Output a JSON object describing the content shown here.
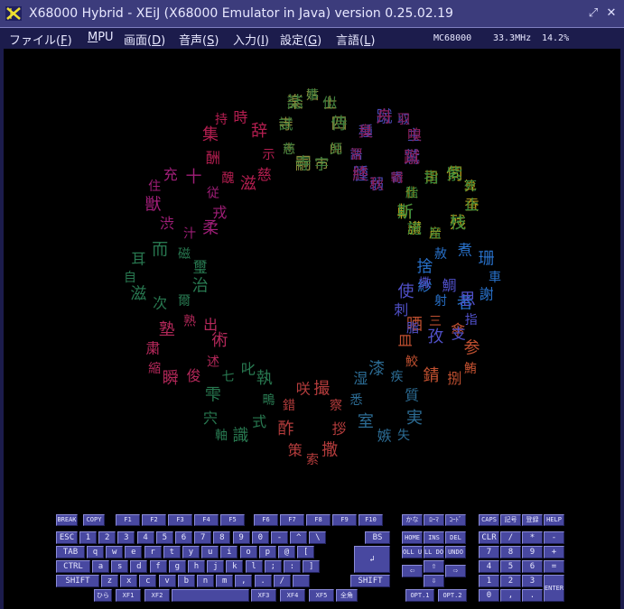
{
  "window": {
    "title": "X68000 Hybrid - XEiJ (X68000 Emulator in Java) version 0.25.02.19",
    "app_icon": "xeij-logo-icon",
    "buttons": [
      "restore-icon",
      "close-icon"
    ]
  },
  "menu": {
    "items": [
      {
        "label": "ファイル(",
        "key": "F",
        "close": ")"
      },
      {
        "label": "",
        "key": "M",
        "close": "PU"
      },
      {
        "label": "画面(",
        "key": "D",
        "close": ")"
      },
      {
        "label": "音声(",
        "key": "S",
        "close": ")"
      },
      {
        "label": "入力(",
        "key": "I",
        "close": ")"
      },
      {
        "label": "設定(",
        "key": "G",
        "close": ")"
      },
      {
        "label": "言語(",
        "key": "L",
        "close": ")"
      }
    ],
    "status": {
      "model": "MC68000",
      "clock": "33.3MHz",
      "load": "14.2%"
    }
  },
  "screen": {
    "petals": [
      {
        "angle": -90,
        "color": "#8c8c3c",
        "words": [
          "姑",
          "士",
          "四",
          "師",
          "市",
          "嗣",
          "志",
          "寺",
          "楽"
        ]
      },
      {
        "angle": -60,
        "color": "#4848b4",
        "words": [
          "取",
          "主",
          "鷲",
          "寄",
          "弱",
          "腫",
          "語",
          "種",
          "蹴"
        ]
      },
      {
        "angle": -30,
        "color": "#b49c1c",
        "words": [
          "算",
          "蚕",
          "残",
          "産",
          "讃",
          "斬",
          "仕",
          "司",
          "伺"
        ]
      },
      {
        "angle": 0,
        "color": "#2870c8",
        "words": [
          "車",
          "謝",
          "者",
          "射",
          "紗",
          "捨",
          "赦",
          "煮",
          "珊"
        ]
      },
      {
        "angle": 30,
        "color": "#c05030",
        "words": [
          "鮪",
          "捌",
          "錆",
          "鮫",
          "皿",
          "晒",
          "三",
          "傘",
          "参"
        ]
      },
      {
        "angle": 60,
        "color": "#2c6c94",
        "words": [
          "失",
          "嫉",
          "室",
          "悉",
          "湿",
          "漆",
          "疾",
          "質",
          "実"
        ]
      },
      {
        "angle": 90,
        "color": "#b43c3c",
        "words": [
          "索",
          "策",
          "酢",
          "錯",
          "咲",
          "撮",
          "察",
          "拶",
          "撒"
        ]
      },
      {
        "angle": 120,
        "color": "#287850",
        "words": [
          "軸",
          "宍",
          "雫",
          "七",
          "叱",
          "執",
          "鴫",
          "式",
          "識"
        ]
      },
      {
        "angle": 150,
        "color": "#b4285a",
        "words": [
          "縮",
          "粛",
          "塾",
          "熟",
          "出",
          "術",
          "述",
          "俊",
          "瞬"
        ]
      },
      {
        "angle": 180,
        "color": "#287850",
        "words": [
          "自",
          "耳",
          "而",
          "磁",
          "璽",
          "治",
          "爾",
          "次",
          "滋"
        ]
      },
      {
        "angle": 210,
        "color": "#a01e78",
        "words": [
          "住",
          "充",
          "十",
          "従",
          "戎",
          "柔",
          "汁",
          "渋",
          "獣"
        ]
      },
      {
        "angle": 240,
        "color": "#b41e50",
        "words": [
          "持",
          "時",
          "辞",
          "示",
          "慈",
          "滋",
          "醜",
          "酬",
          "集"
        ]
      },
      {
        "angle": 270,
        "color": "#3c7c3c",
        "words": [
          "事",
          "似",
          "侍",
          "児",
          "字",
          "寺",
          "慈",
          "試",
          "誌"
        ]
      },
      {
        "angle": 300,
        "color": "#8c1e5a",
        "words": [
          "羽",
          "嗅",
          "蹴",
          "輯",
          "秋",
          "終",
          "習",
          "臭",
          "舟"
        ]
      },
      {
        "angle": 330,
        "color": "#3c8c3c",
        "words": [
          "死",
          "止",
          "枝",
          "旨",
          "施",
          "斯",
          "脂",
          "指",
          "紫"
        ]
      },
      {
        "angle": 15,
        "color": "#5050c8",
        "words": [
          "指",
          "支",
          "孜",
          "脂",
          "刺",
          "使",
          "撒",
          "鯛",
          "思"
        ]
      }
    ]
  },
  "keyboard": {
    "row0_left": [
      "BREAK",
      "COPY"
    ],
    "fkeys": [
      "F1",
      "F2",
      "F3",
      "F4",
      "F5",
      "F6",
      "F7",
      "F8",
      "F9",
      "F10"
    ],
    "row0_mid": [
      "かな",
      "ﾛｰﾏ",
      "ｺｰﾄﾞ"
    ],
    "row0_right": [
      "CAPS",
      "記号",
      "登録",
      "HELP"
    ],
    "row1": [
      "ESC",
      "1",
      "2",
      "3",
      "4",
      "5",
      "6",
      "7",
      "8",
      "9",
      "0",
      "-",
      "^",
      "\\",
      "BS"
    ],
    "row2": [
      "TAB",
      "q",
      "w",
      "e",
      "r",
      "t",
      "y",
      "u",
      "i",
      "o",
      "p",
      "@",
      "["
    ],
    "row3": [
      "CTRL",
      "a",
      "s",
      "d",
      "f",
      "g",
      "h",
      "j",
      "k",
      "l",
      ";",
      ":",
      "]"
    ],
    "row4": [
      "SHIFT",
      "z",
      "x",
      "c",
      "v",
      "b",
      "n",
      "m",
      ",",
      ".",
      "/",
      "",
      "SHIFT"
    ],
    "row5": [
      "ひら",
      "XF1",
      "XF2",
      "",
      "XF3",
      "XF4",
      "XF5",
      "全角"
    ],
    "return_key": "↲",
    "nav_row1": [
      "HOME",
      "INS",
      "DEL"
    ],
    "nav_row2": [
      "ROLL UP",
      "ROLL DOWN",
      "UNDO"
    ],
    "arrows": {
      "left": "⇦",
      "up": "⇧",
      "right": "⇨",
      "down": "⇩"
    },
    "opt": [
      "OPT.1",
      "OPT.2"
    ],
    "numpad": [
      [
        "CLR",
        "/",
        "*",
        "-"
      ],
      [
        "7",
        "8",
        "9",
        "+"
      ],
      [
        "4",
        "5",
        "6",
        "="
      ],
      [
        "1",
        "2",
        "3",
        ""
      ],
      [
        "0",
        ",",
        ".",
        ""
      ]
    ],
    "enter": "ENTER"
  }
}
